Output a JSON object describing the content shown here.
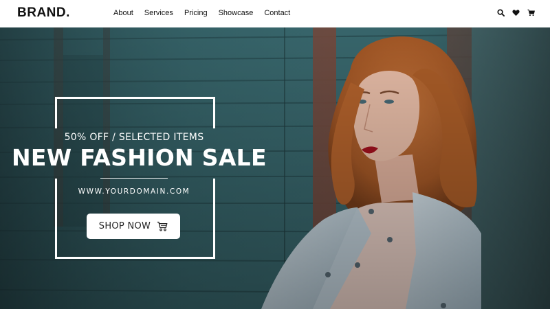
{
  "header": {
    "brand": "BRAND.",
    "nav": [
      {
        "label": "About"
      },
      {
        "label": "Services"
      },
      {
        "label": "Pricing"
      },
      {
        "label": "Showcase"
      },
      {
        "label": "Contact"
      }
    ],
    "icons": [
      "search-icon",
      "heart-icon",
      "cart-icon"
    ]
  },
  "hero": {
    "offer": "50% OFF / SELECTED ITEMS",
    "headline": "NEW FASHION SALE",
    "domain": "WWW.YOURDOMAIN.COM",
    "button_label": "SHOP NOW",
    "button_icon": "cart-icon"
  },
  "colors": {
    "header_bg": "#ffffff",
    "text_dark": "#111111",
    "hero_wall": "#2f5a5f",
    "hero_text": "#ffffff",
    "button_bg": "#ffffff"
  }
}
